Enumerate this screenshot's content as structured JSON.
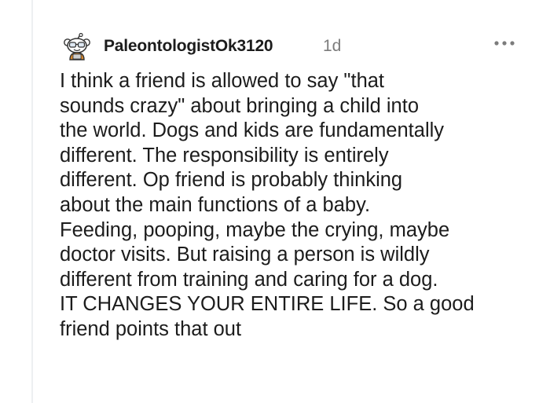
{
  "comment": {
    "username": "PaleontologistOk3120",
    "age": "1d",
    "more_icon": "more-options-icon",
    "avatar_icon": "snoo-avatar-icon",
    "body_lines": [
      "I think a friend is allowed to say \"that",
      "sounds crazy\" about bringing a child into",
      "the world. Dogs and kids are fundamentally",
      "different. The responsibility is entirely",
      "different. Op friend is probably thinking",
      "about the main functions of a baby.",
      "Feeding, pooping, maybe the crying, maybe",
      "doctor visits. But raising a person is wildly",
      "different from training and caring for a dog.",
      "IT CHANGES YOUR ENTIRE LIFE. So a good",
      "friend points that out"
    ]
  },
  "colors": {
    "text": "#1c1c1c",
    "meta": "#7c7c7c",
    "thread_line": "#edeff1"
  }
}
